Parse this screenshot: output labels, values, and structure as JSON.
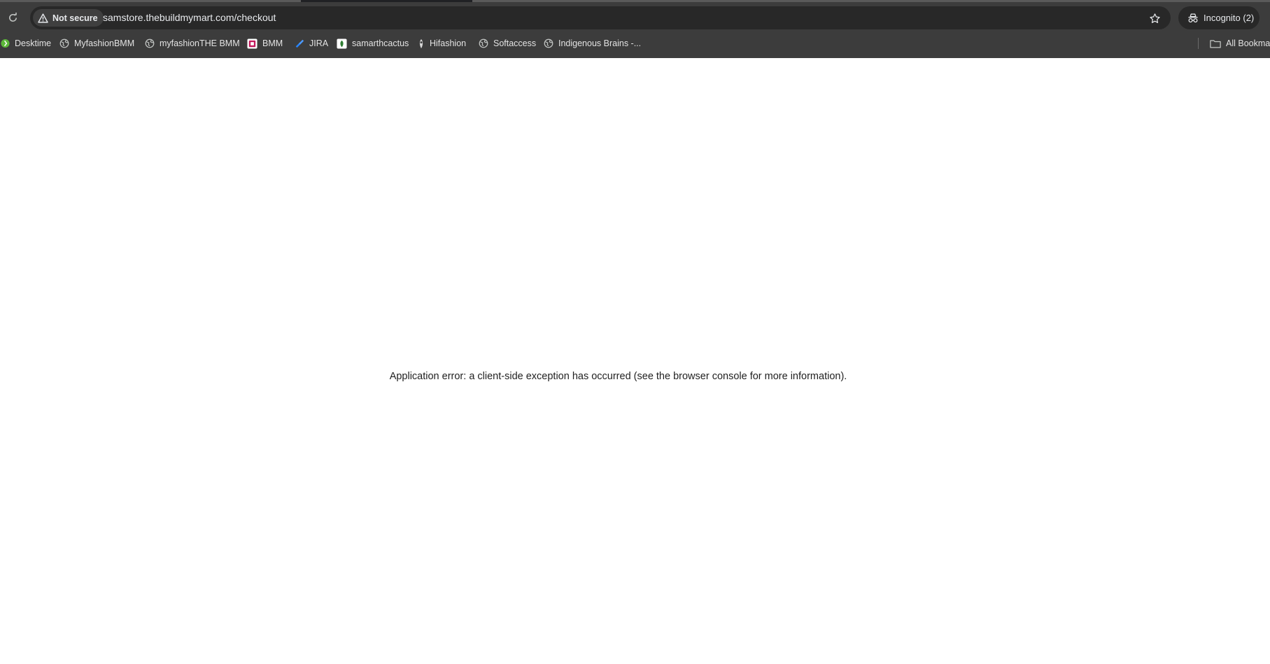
{
  "browser": {
    "security_label": "Not secure",
    "url": "samstore.thebuildmymart.com/checkout",
    "profile_label": "Incognito (2)",
    "icons": {
      "reload": "reload-icon",
      "warning": "warning-icon",
      "star": "star-icon",
      "incognito": "incognito-icon",
      "folder": "folder-icon"
    }
  },
  "bookmarks": {
    "items": [
      {
        "label": "Desktime",
        "icon": "desktime-icon"
      },
      {
        "label": "MyfashionBMM",
        "icon": "globe-icon"
      },
      {
        "label": "myfashionTHE BMM",
        "icon": "globe-icon"
      },
      {
        "label": "BMM",
        "icon": "bmm-icon"
      },
      {
        "label": "JIRA",
        "icon": "jira-icon"
      },
      {
        "label": "samarthcactus",
        "icon": "cactus-icon"
      },
      {
        "label": "Hifashion",
        "icon": "hifashion-icon"
      },
      {
        "label": "Softaccess",
        "icon": "globe-icon"
      },
      {
        "label": "Indigenous Brains -...",
        "icon": "globe-icon"
      }
    ],
    "all_bookmarks_label": "All Bookma"
  },
  "page": {
    "error_message": "Application error: a client-side exception has occurred (see the browser console for more information)."
  },
  "colors": {
    "chrome_background": "#3c3c3c",
    "omnibox_background": "#282828",
    "page_background": "#ffffff",
    "error_text": "#1f1f1f"
  }
}
